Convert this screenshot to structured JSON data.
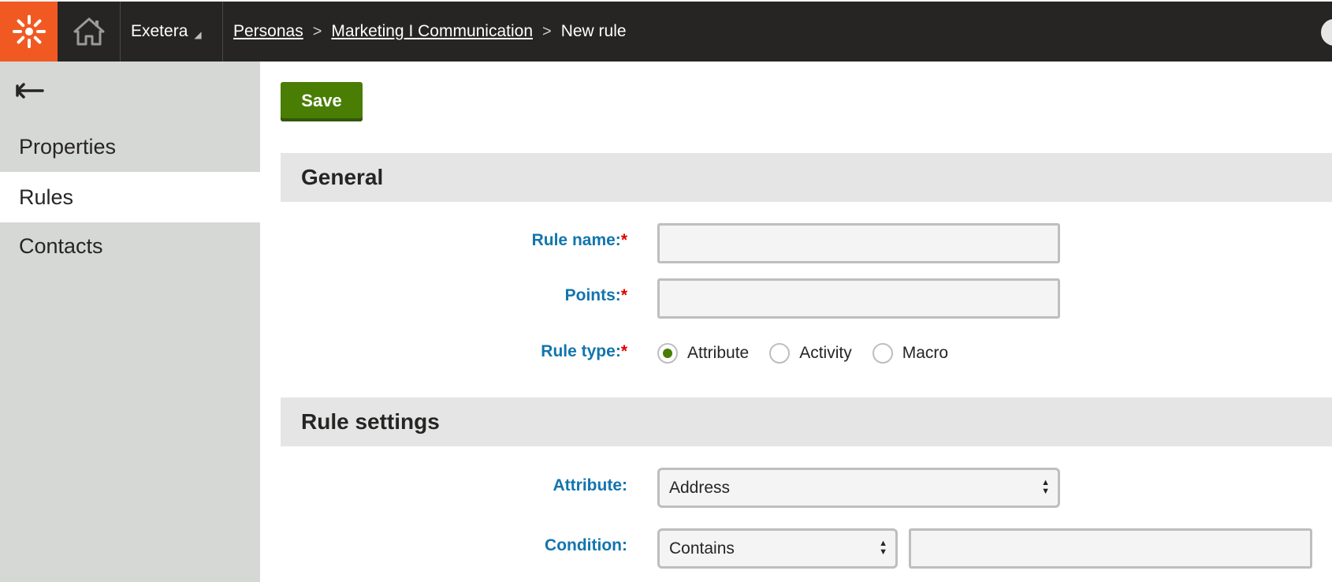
{
  "header": {
    "site_name": "Exetera",
    "breadcrumb": {
      "item1": "Personas",
      "item2": "Marketing I Communication",
      "current": "New rule"
    },
    "separator": ">"
  },
  "sidebar": {
    "items": [
      {
        "label": "Properties"
      },
      {
        "label": "Rules"
      },
      {
        "label": "Contacts"
      }
    ]
  },
  "toolbar": {
    "save_label": "Save"
  },
  "sections": {
    "general": {
      "title": "General",
      "rule_name_label": "Rule name:",
      "rule_name_value": "",
      "points_label": "Points:",
      "points_value": "",
      "rule_type_label": "Rule type:",
      "required_mark": "*",
      "rule_type_options": [
        {
          "label": "Attribute",
          "selected": true
        },
        {
          "label": "Activity",
          "selected": false
        },
        {
          "label": "Macro",
          "selected": false
        }
      ]
    },
    "rule_settings": {
      "title": "Rule settings",
      "attribute_label": "Attribute:",
      "attribute_value": "Address",
      "condition_label": "Condition:",
      "condition_value": "Contains",
      "condition_text_value": ""
    }
  },
  "colors": {
    "accent_orange": "#f05a22",
    "save_green": "#497d04",
    "label_blue": "#1175ae",
    "required_red": "#e00000",
    "topbar_bg": "#262524"
  }
}
